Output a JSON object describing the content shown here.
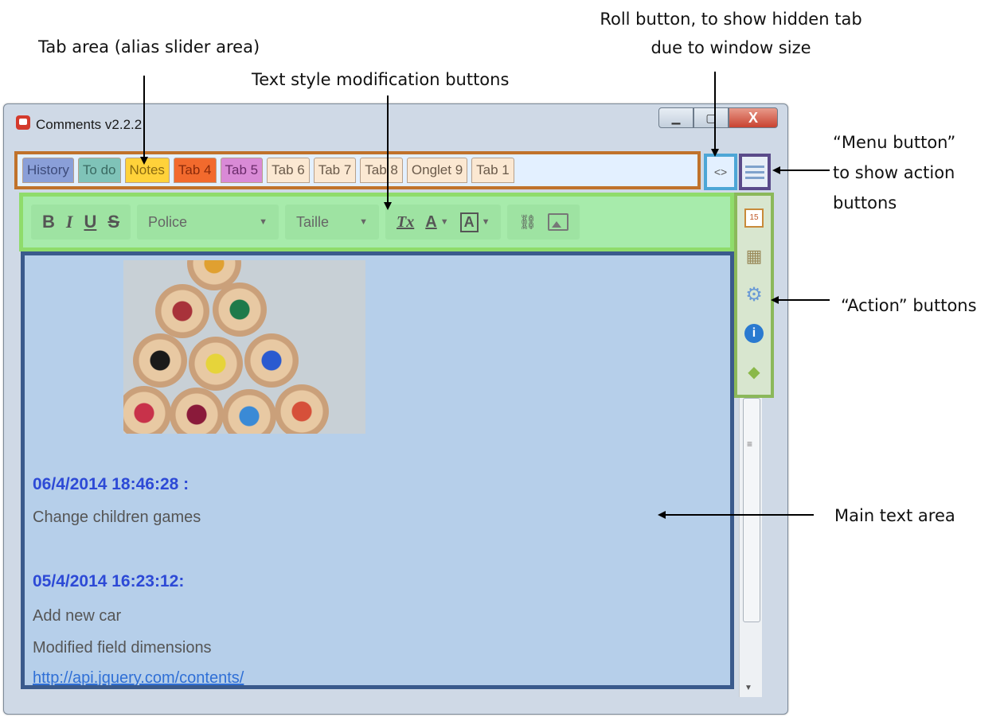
{
  "annotations": {
    "tab_area": "Tab area (alias slider area)",
    "text_style": "Text style modification buttons",
    "roll_line1": "Roll button, to show hidden tab",
    "roll_line2": "due to window size",
    "menu_line1": "“Menu button”",
    "menu_line2": "to show action",
    "menu_line3": "buttons",
    "action": "“Action” buttons",
    "main": "Main text area"
  },
  "window": {
    "title": "Comments v2.2.2",
    "minimize_icon": "minimize-icon",
    "maximize_icon": "maximize-icon",
    "close_glyph": "X"
  },
  "tabs": [
    {
      "label": "History",
      "color": "#8a9fd8"
    },
    {
      "label": "To do",
      "color": "#7fc3b8"
    },
    {
      "label": "Notes",
      "color": "#ffd23a"
    },
    {
      "label": "Tab 4",
      "color": "#f26a2d"
    },
    {
      "label": "Tab 5",
      "color": "#d98ad6"
    },
    {
      "label": "Tab 6",
      "color": "#fbe8d2"
    },
    {
      "label": "Tab 7",
      "color": "#fbe8d2"
    },
    {
      "label": "Tab 8",
      "color": "#fbe8d2"
    },
    {
      "label": "Onglet 9",
      "color": "#fbe8d2"
    },
    {
      "label": "Tab 1",
      "color": "#fbe8d2"
    }
  ],
  "roll_button": "<>",
  "toolbar": {
    "bold": "B",
    "italic": "I",
    "underline": "U",
    "strike": "S",
    "font_select": "Police",
    "size_select": "Taille",
    "clear_format": "Tx",
    "text_color": "A",
    "bg_color": "A"
  },
  "entries": {
    "date1": "06/4/2014 18:46:28 :",
    "text1": "Change children games",
    "date2": "05/4/2014 16:23:12:",
    "text2a": "Add new car",
    "text2b": "Modified field dimensions",
    "link": "http://api.jquery.com/contents/"
  },
  "actions": {
    "calendar": "15"
  }
}
